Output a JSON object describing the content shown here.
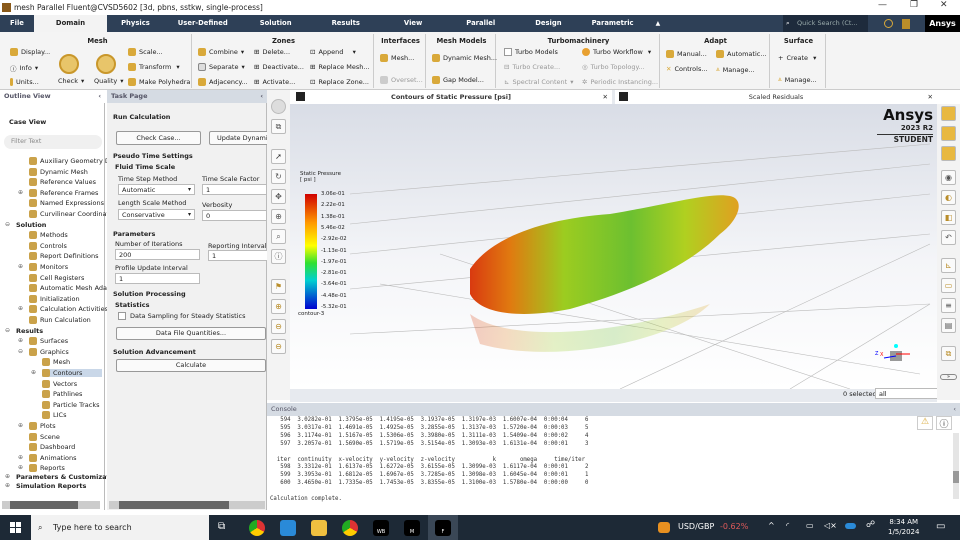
{
  "window": {
    "title": "mesh Parallel Fluent@CVSD5602  [3d, pbns, sstkw, single-process]",
    "min": "—",
    "max": "❐",
    "close": "✕"
  },
  "menu_tabs": [
    "File",
    "Domain",
    "Physics",
    "User-Defined",
    "Solution",
    "Results",
    "View",
    "Parallel",
    "Design",
    "Parametric"
  ],
  "collapse_ribbon": "▲",
  "search_placeholder": "Quick Search (Ct...",
  "brand": "Ansys",
  "ribbon": {
    "mesh": {
      "title": "Mesh",
      "display": "Display...",
      "info": "Info",
      "units": "Units...",
      "check": "Check",
      "quality": "Quality",
      "scale": "Scale...",
      "transform": "Transform",
      "polyhedra": "Make Polyhedra"
    },
    "zones": {
      "title": "Zones",
      "combine": "Combine",
      "separate": "Separate",
      "adjacency": "Adjacency...",
      "delete": "Delete...",
      "deactivate": "Deactivate...",
      "activate": "Activate...",
      "append": "Append",
      "replace_mesh": "Replace Mesh...",
      "replace_zone": "Replace Zone..."
    },
    "interfaces": {
      "title": "Interfaces",
      "mesh": "Mesh...",
      "overset": "Overset..."
    },
    "mesh_models": {
      "title": "Mesh Models",
      "dynamic": "Dynamic Mesh...",
      "gap": "Gap Model..."
    },
    "turbo": {
      "title": "Turbomachinery",
      "models": "Turbo Models",
      "create": "Turbo Create...",
      "spectral": "Spectral Content",
      "workflow": "Turbo Workflow",
      "topology": "Turbo Topology...",
      "periodic": "Periodic Instancing..."
    },
    "adapt": {
      "title": "Adapt",
      "manual": "Manual...",
      "controls": "Controls...",
      "automatic": "Automatic...",
      "manage": "Manage..."
    },
    "surface": {
      "title": "Surface",
      "create": "Create",
      "manage": "Manage..."
    }
  },
  "outline": {
    "title": "Outline View",
    "case_view": "Case View",
    "filter_placeholder": "Filter Text",
    "items": [
      "Auxiliary Geometry De",
      "Dynamic Mesh",
      "Reference Values",
      "Reference Frames",
      "Named Expressions",
      "Curvilinear Coordinat",
      "Solution",
      "Methods",
      "Controls",
      "Report Definitions",
      "Monitors",
      "Cell Registers",
      "Automatic Mesh Adap",
      "Initialization",
      "Calculation Activities",
      "Run Calculation",
      "Results",
      "Surfaces",
      "Graphics",
      "Mesh",
      "Contours",
      "Vectors",
      "Pathlines",
      "Particle Tracks",
      "LICs",
      "Plots",
      "Scene",
      "Dashboard",
      "Animations",
      "Reports",
      "Parameters & Customizatio",
      "Simulation Reports"
    ]
  },
  "task": {
    "title": "Task Page",
    "heading": "Run Calculation",
    "check_case": "Check Case...",
    "update_dynamic": "Update Dynamic",
    "pseudo": "Pseudo Time Settings",
    "fluid_ts": "Fluid Time Scale",
    "tsm_label": "Time Step Method",
    "tsm": "Automatic",
    "tsf_label": "Time Scale Factor",
    "tsf": "1",
    "lsm_label": "Length Scale Method",
    "lsm": "Conservative",
    "verb_label": "Verbosity",
    "verb": "0",
    "parameters": "Parameters",
    "iter_label": "Number of Iterations",
    "iter": "200",
    "rep_label": "Reporting Interval",
    "rep": "1",
    "pui_label": "Profile Update Interval",
    "pui": "1",
    "processing": "Solution Processing",
    "statistics": "Statistics",
    "sampling": "Data Sampling for Steady Statistics",
    "dfq": "Data File Quantities...",
    "advancement": "Solution Advancement",
    "calculate": "Calculate"
  },
  "graphics": {
    "tab1": "Contours of Static Pressure [psi]",
    "tab2": "Scaled Residuals",
    "logo": "Ansys",
    "version": "2023 R2",
    "edition": "STUDENT",
    "legend_title": "Static Pressure",
    "legend_unit": "[ psi ]",
    "legend_ticks": [
      "3.06e-01",
      "2.22e-01",
      "1.38e-01",
      "5.46e-02",
      "-2.92e-02",
      "-1.13e-01",
      "-1.97e-01",
      "-2.81e-01",
      "-3.64e-01",
      "-4.48e-01",
      "-5.32e-01"
    ],
    "legend_name": "contour-3",
    "selected": "0 selected",
    "filter": "all",
    "axes": {
      "x": "X",
      "z": "Z"
    }
  },
  "console": {
    "title": "Console",
    "lines": [
      "   594  3.0282e-01  1.3795e-05  1.4195e-05  3.1937e-05  1.3197e-03  1.6007e-04  0:00:04     6",
      "   595  3.0317e-01  1.4691e-05  1.4925e-05  3.2855e-05  1.3137e-03  1.5720e-04  0:00:03     5",
      "   596  3.1174e-01  1.5167e-05  1.5306e-05  3.3980e-05  1.3111e-03  1.5409e-04  0:00:02     4",
      "   597  3.2057e-01  1.5690e-05  1.5719e-05  3.5154e-05  1.3093e-03  1.6131e-04  0:00:01     3",
      "",
      "  iter  continuity  x-velocity  y-velocity  z-velocity           k       omega     time/iter",
      "   598  3.3312e-01  1.6137e-05  1.6272e-05  3.6155e-05  1.3099e-03  1.6117e-04  0:00:01     2",
      "   599  3.3953e-01  1.6812e-05  1.6967e-05  3.7285e-05  1.3098e-03  1.6045e-04  0:00:01     1",
      "   600  3.4650e-01  1.7335e-05  1.7453e-05  3.8355e-05  1.3100e-03  1.5780e-04  0:00:00     0",
      "",
      "Calculation complete."
    ]
  },
  "taskbar": {
    "search": "Type here to search",
    "apps": [
      "WB",
      "M",
      "F"
    ],
    "ticker": "USD/GBP",
    "change": "-0.62%",
    "time": "8:34 AM",
    "date": "1/5/2024"
  },
  "colors": {
    "tabbar": "#2e4057",
    "taskbar": "#1d2936",
    "change": "#e05a5a"
  }
}
